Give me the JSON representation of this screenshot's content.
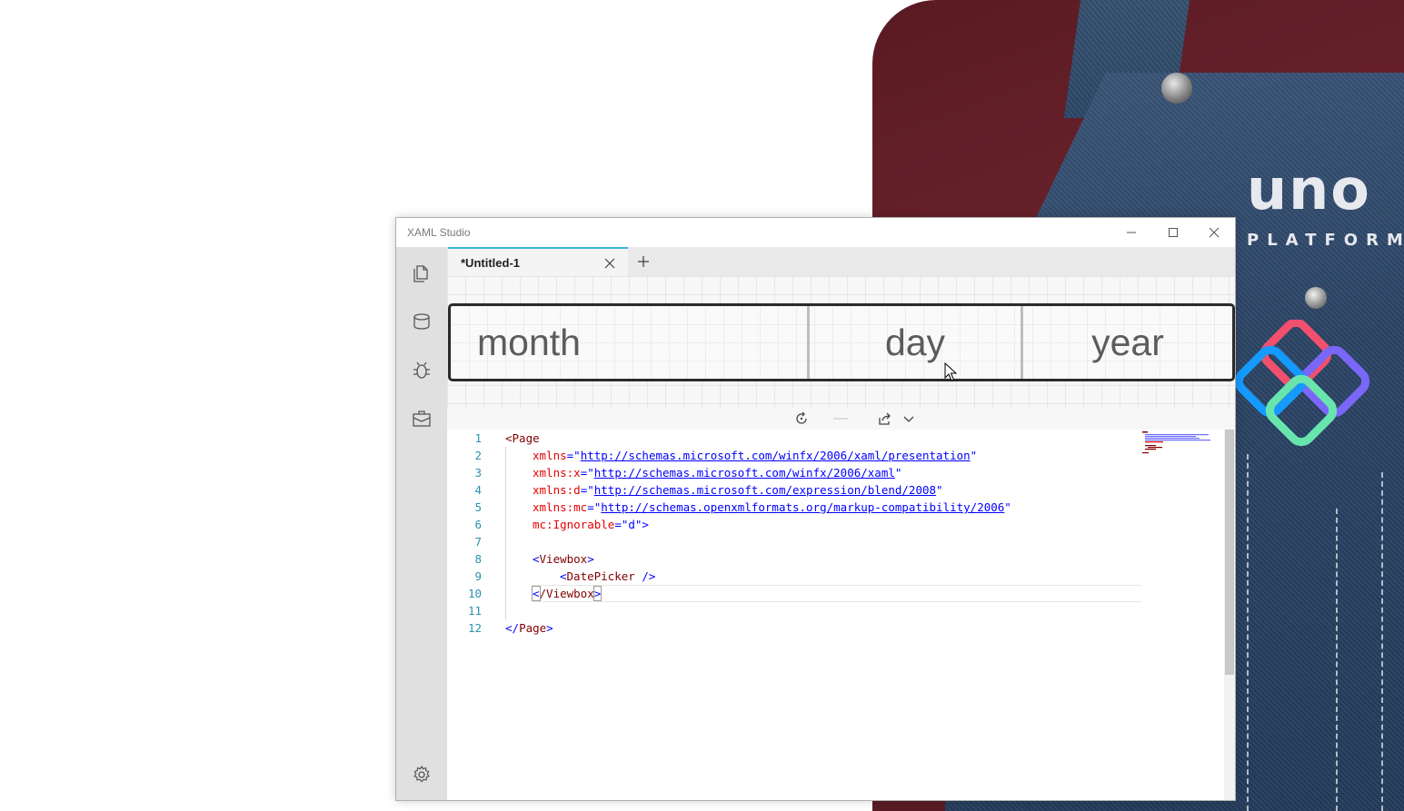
{
  "window": {
    "title": "XAML Studio"
  },
  "wallpaper": {
    "brand": "uno",
    "brand_sub": "PLATFORM"
  },
  "sidebar": {
    "items": [
      {
        "icon": "documents-icon"
      },
      {
        "icon": "database-icon"
      },
      {
        "icon": "bug-icon"
      },
      {
        "icon": "toolbox-icon"
      }
    ],
    "settings_icon": "gear-icon"
  },
  "tabs": [
    {
      "label": "*Untitled-1",
      "active": true
    }
  ],
  "preview": {
    "datepicker": {
      "month_placeholder": "month",
      "day_placeholder": "day",
      "year_placeholder": "year"
    }
  },
  "editor": {
    "line_numbers": [
      "1",
      "2",
      "3",
      "4",
      "5",
      "6",
      "7",
      "8",
      "9",
      "10",
      "11",
      "12"
    ],
    "lines": {
      "l1_open": "<",
      "l1_tag": "Page",
      "l2_attr": "xmlns",
      "l2_q1": "=\"",
      "l2_url": "http://schemas.microsoft.com/winfx/2006/xaml/presentation",
      "l2_q2": "\"",
      "l3_attr": "xmlns:x",
      "l3_q1": "=\"",
      "l3_url": "http://schemas.microsoft.com/winfx/2006/xaml",
      "l3_q2": "\"",
      "l4_attr": "xmlns:d",
      "l4_q1": "=\"",
      "l4_url": "http://schemas.microsoft.com/expression/blend/2008",
      "l4_q2": "\"",
      "l5_attr": "xmlns:mc",
      "l5_q1": "=\"",
      "l5_url": "http://schemas.openxmlformats.org/markup-compatibility/2006",
      "l5_q2": "\"",
      "l6_attr": "mc:Ignorable",
      "l6_val": "=\"d\">",
      "l8_open": "<",
      "l8_tag": "Viewbox",
      "l8_close": ">",
      "l9_open": "<",
      "l9_tag": "DatePicker",
      "l9_close": " />",
      "l10_open": "<",
      "l10_tag": "/Viewbox",
      "l10_close": ">",
      "l12_open": "</",
      "l12_tag": "Page",
      "l12_close": ">"
    }
  },
  "colors": {
    "accent": "#38b6d4",
    "sidebar_bg": "#e0e0e0",
    "xml_tag": "#800000",
    "xml_attr": "#e50000",
    "xml_value": "#0000ff",
    "line_number": "#2b91af"
  }
}
